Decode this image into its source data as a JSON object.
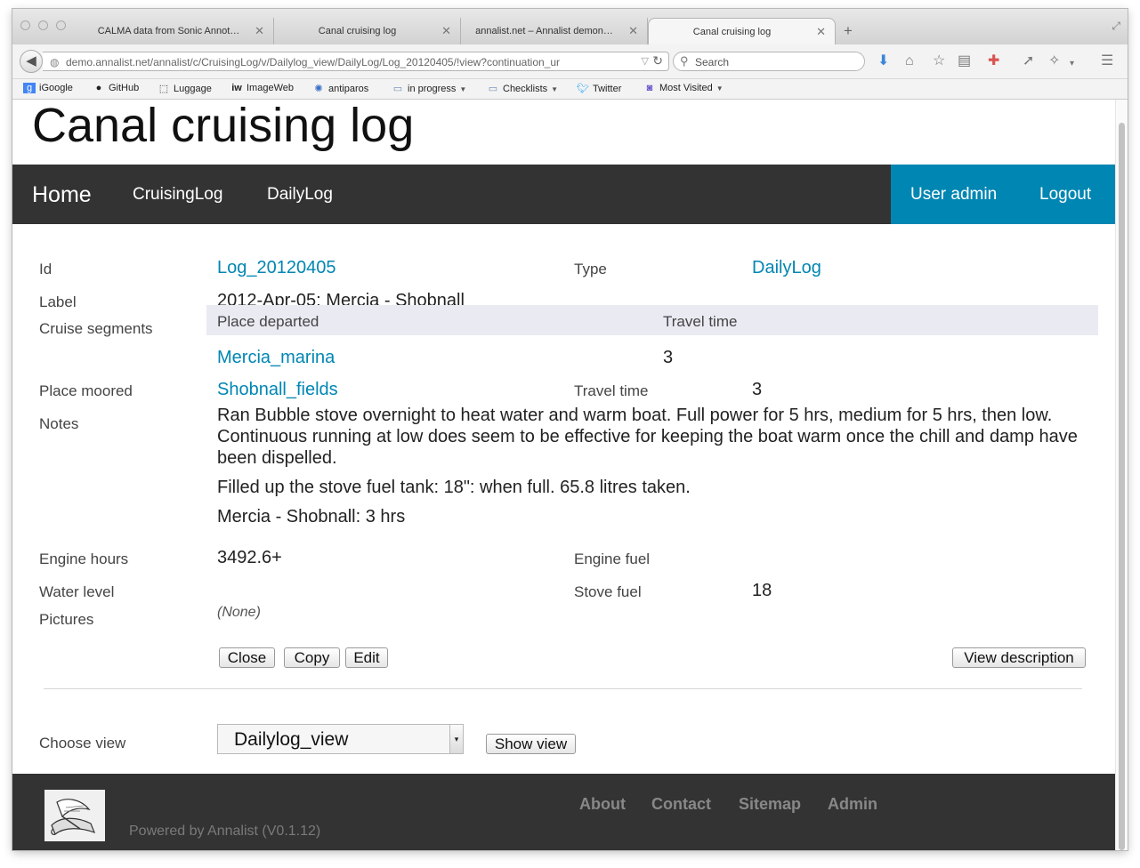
{
  "browser": {
    "tabs": [
      {
        "title": "CALMA data from Sonic Annot…"
      },
      {
        "title": "Canal cruising log"
      },
      {
        "title": "annalist.net – Annalist demon…"
      },
      {
        "title": "Canal cruising log"
      }
    ],
    "url": "demo.annalist.net/annalist/c/CruisingLog/v/Dailylog_view/DailyLog/Log_20120405/!view?continuation_ur",
    "search_placeholder": "Search",
    "bookmarks": [
      {
        "label": "iGoogle",
        "icon": "google-icon"
      },
      {
        "label": "GitHub",
        "icon": "github-icon"
      },
      {
        "label": "Luggage",
        "icon": "luggage-icon"
      },
      {
        "label": "ImageWeb",
        "icon": "imageweb-icon"
      },
      {
        "label": "antiparos",
        "icon": "antiparos-icon"
      },
      {
        "label": "in progress",
        "icon": "folder-icon"
      },
      {
        "label": "Checklists",
        "icon": "folder-icon"
      },
      {
        "label": "Twitter",
        "icon": "twitter-icon"
      },
      {
        "label": "Most Visited",
        "icon": "most-visited-icon"
      }
    ]
  },
  "site": {
    "title": "Canal cruising log",
    "nav": {
      "home": "Home",
      "cruisinglog": "CruisingLog",
      "dailylog": "DailyLog",
      "user_admin": "User admin",
      "logout": "Logout"
    }
  },
  "record": {
    "id_label": "Id",
    "id_value": "Log_20120405",
    "type_label": "Type",
    "type_value": "DailyLog",
    "label_label": "Label",
    "label_value": "2012-Apr-05: Mercia - Shobnall",
    "segments_label": "Cruise segments",
    "seg_col_departed": "Place departed",
    "seg_col_travel": "Travel time",
    "seg_rows": [
      {
        "place": "Mercia_marina",
        "travel": "3"
      }
    ],
    "moored_label": "Place moored",
    "moored_value": "Shobnall_fields",
    "travel_label": "Travel time",
    "travel_value": "3",
    "notes_label": "Notes",
    "notes": [
      "Ran Bubble stove overnight to heat water and warm boat. Full power for 5 hrs, medium for 5 hrs, then low. Continuous running at low does seem to be effective for keeping the boat warm once the chill and damp have been dispelled.",
      "Filled up the stove fuel tank: 18\": when full. 65.8 litres taken.",
      "Mercia - Shobnall: 3 hrs"
    ],
    "engine_hours_label": "Engine hours",
    "engine_hours_value": "3492.6+",
    "engine_fuel_label": "Engine fuel",
    "water_level_label": "Water level",
    "stove_fuel_label": "Stove fuel",
    "stove_fuel_value": "18",
    "pictures_label": "Pictures",
    "pictures_value": "(None)"
  },
  "buttons": {
    "close": "Close",
    "copy": "Copy",
    "edit": "Edit",
    "view_description": "View description",
    "show_view": "Show view"
  },
  "choose_view": {
    "label": "Choose view",
    "selected": "Dailylog_view"
  },
  "footer": {
    "powered": "Powered by Annalist (V0.1.12)",
    "about": "About",
    "contact": "Contact",
    "sitemap": "Sitemap",
    "admin": "Admin"
  },
  "colors": {
    "nav_bg": "#333333",
    "accent": "#0086b3",
    "link": "#0086b3"
  }
}
